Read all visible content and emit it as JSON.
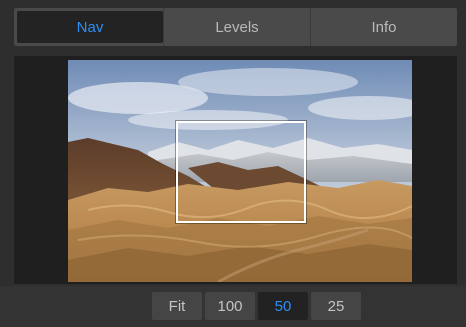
{
  "tabs": [
    {
      "label": "Nav",
      "active": true
    },
    {
      "label": "Levels",
      "active": false
    },
    {
      "label": "Info",
      "active": false
    }
  ],
  "zoom": {
    "options": [
      "Fit",
      "100",
      "50",
      "25"
    ],
    "selected": "50"
  },
  "colors": {
    "accent": "#2f8ef5",
    "panel_bg": "#2e2e2e",
    "tab_bg": "#4a4a4a"
  }
}
